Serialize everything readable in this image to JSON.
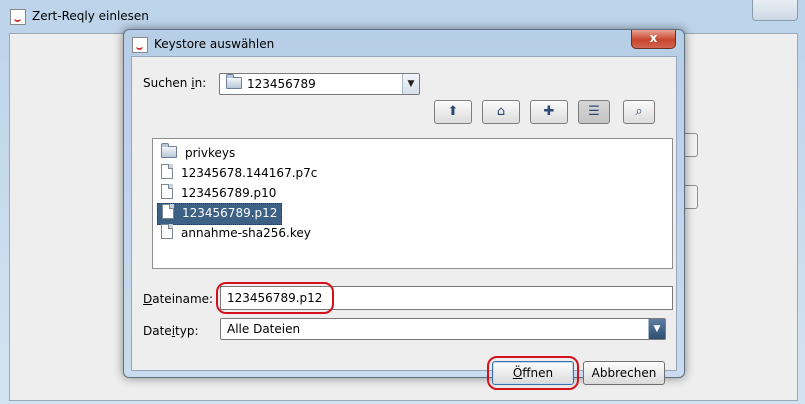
{
  "parent_window": {
    "title": "Zert-Reqly einlesen"
  },
  "dialog": {
    "title": "Keystore auswählen",
    "close_label": "x",
    "look_in": {
      "label_before": "Suchen ",
      "label_mnemonic": "i",
      "label_after": "n:",
      "current_folder": "123456789"
    },
    "toolbar": [
      {
        "name": "up-one-level-button",
        "icon": "folder-up-icon",
        "glyph": "⬆"
      },
      {
        "name": "home-button",
        "icon": "home-icon",
        "glyph": "⌂"
      },
      {
        "name": "new-folder-button",
        "icon": "new-folder-icon",
        "glyph": "✚"
      },
      {
        "name": "list-view-button",
        "icon": "list-view-icon",
        "glyph": "☰"
      },
      {
        "name": "details-view-button",
        "icon": "details-view-icon",
        "glyph": "⌕"
      }
    ],
    "files": [
      {
        "name": "privkeys",
        "type": "folder",
        "selected": false
      },
      {
        "name": "12345678.144167.p7c",
        "type": "file",
        "selected": false
      },
      {
        "name": "123456789.p10",
        "type": "file",
        "selected": false
      },
      {
        "name": "123456789.p12",
        "type": "file",
        "selected": true
      },
      {
        "name": "annahme-sha256.key",
        "type": "file",
        "selected": false
      }
    ],
    "filename": {
      "label_mnemonic": "D",
      "label_rest": "ateiname:",
      "value": "123456789.p12"
    },
    "filetype": {
      "label_before": "Date",
      "label_mnemonic": "i",
      "label_after": "typ:",
      "value": "Alle Dateien"
    },
    "buttons": {
      "open_mnemonic": "Ö",
      "open_rest": "ffnen",
      "cancel": "Abbrechen"
    },
    "colors": {
      "selection": "#3d6185",
      "highlight_ring": "#d4121b",
      "title_bar": "#b7cee7"
    }
  }
}
